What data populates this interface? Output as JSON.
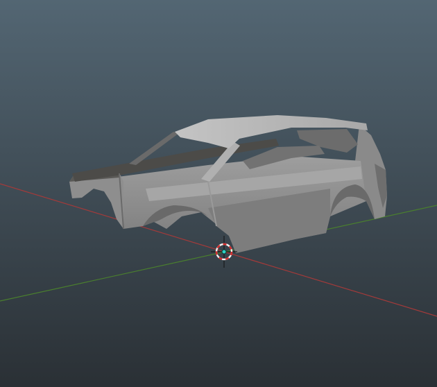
{
  "viewport": {
    "background_top": "#536673",
    "background_bottom": "#2a3035"
  },
  "axes": {
    "x_axis_color": "#a33a3a",
    "y_axis_color": "#4a7f2e"
  },
  "object": {
    "name": "car-body-shell",
    "body_color": "#8c8c8c",
    "highlight_color": "#b5b5b5",
    "shadow_color": "#6e6e6e",
    "dark_color": "#4c4b48"
  },
  "cursor": {
    "icon": "3d-cursor-icon",
    "ring_red": "#d62c2c",
    "ring_white": "#f2f2f2",
    "origin_color": "#2fd1c4"
  }
}
